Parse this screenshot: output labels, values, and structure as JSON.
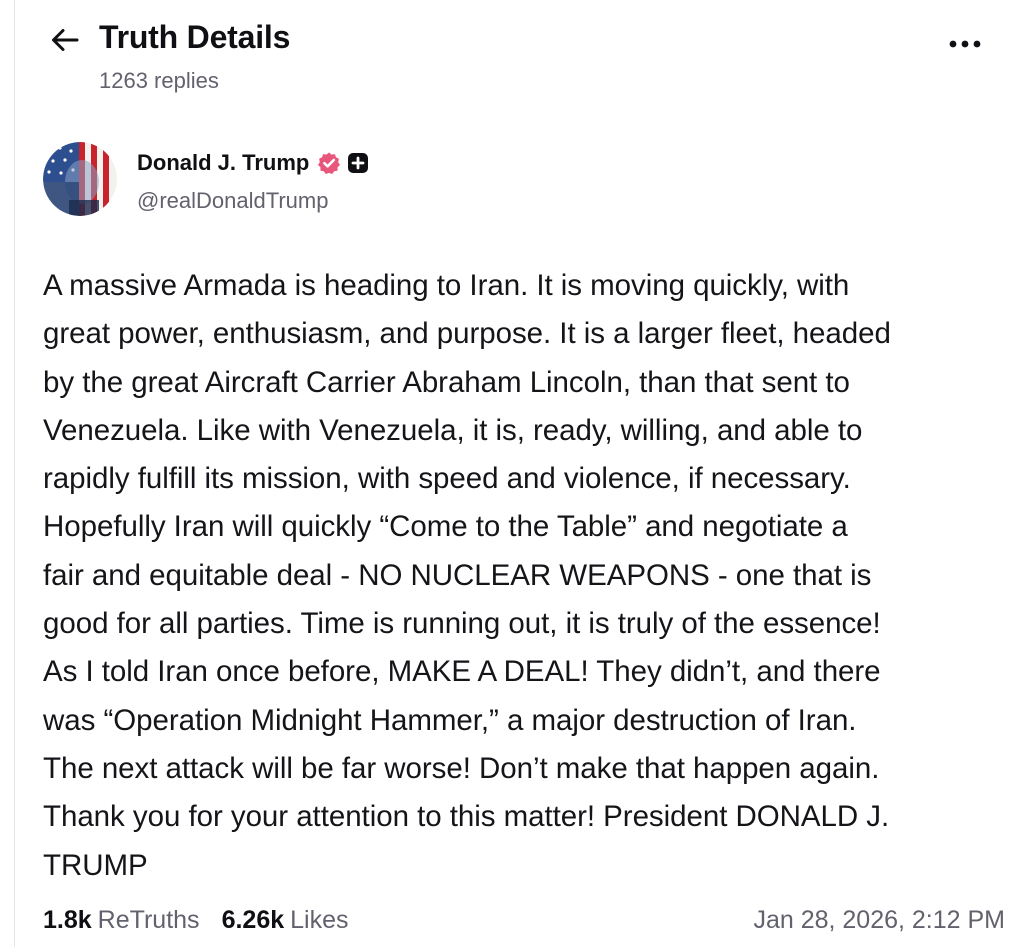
{
  "header": {
    "title": "Truth Details",
    "replies": "1263 replies",
    "back_icon": "arrow-left-icon",
    "more_icon": "more-horizontal-icon"
  },
  "author": {
    "name": "Donald J. Trump",
    "handle": "@realDonaldTrump",
    "verified_color": "#e8567b"
  },
  "post": {
    "lines": [
      "A massive Armada is heading to Iran. It is moving quickly, with",
      "great power, enthusiasm, and purpose. It is a larger fleet, headed",
      "by the great Aircraft Carrier Abraham Lincoln, than that sent to",
      "Venezuela. Like with Venezuela, it is, ready, willing, and able to",
      "rapidly fulfill its mission, with speed and violence, if necessary.",
      "Hopefully Iran will quickly “Come to the Table” and negotiate a",
      "fair and equitable deal - NO NUCLEAR WEAPONS - one that is",
      "good for all parties. Time is running out, it is truly of the essence!",
      "As I told Iran once before, MAKE A DEAL! They didn’t, and there",
      "was “Operation Midnight Hammer,” a major destruction of Iran.",
      "The next attack will be far worse! Don’t make that happen again.",
      "Thank you for your attention to this matter!  President DONALD J.",
      "TRUMP"
    ]
  },
  "stats": {
    "retruths_count": "1.8k",
    "retruths_label": "ReTruths",
    "likes_count": "6.26k",
    "likes_label": "Likes"
  },
  "timestamp": "Jan 28, 2026, 2:12 PM"
}
